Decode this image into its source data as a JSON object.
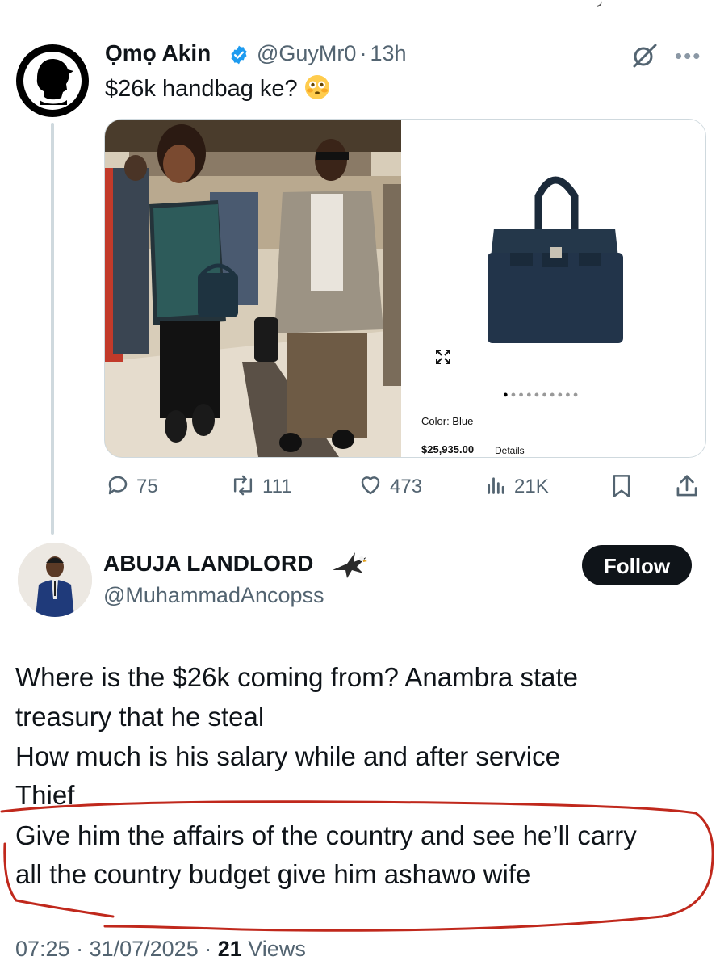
{
  "parent_tweet": {
    "display_name": "Ọmọ Akin",
    "handle": "@GuyMr0",
    "time": "13h",
    "text": "$26k handbag ke?",
    "emoji": "flushed-face",
    "media": {
      "product": {
        "color_label": "Color: Blue",
        "price": "$25,935.00",
        "details_link": "Details",
        "carousel_total": 10,
        "carousel_active": 1
      }
    },
    "stats": {
      "replies": "75",
      "reposts": "111",
      "likes": "473",
      "views": "21K"
    }
  },
  "reply": {
    "display_name": "ABUJA LANDLORD",
    "handle": "@MuhammadAncopss",
    "follow_label": "Follow",
    "lines": [
      "Where is the $26k coming from? Anambra state",
      "treasury that he steal",
      "How much is his salary while and after service",
      "Thief",
      "Give him the affairs of the country and see he’ll carry",
      "all the country budget give him ashawo wife"
    ],
    "time": "07:25",
    "date": "31/07/2025",
    "views_count": "21",
    "views_label": "Views"
  },
  "colors": {
    "text": "#0f1419",
    "secondary": "#536471",
    "verified": "#1d9bf0",
    "highlight_circle": "#c0281c"
  }
}
